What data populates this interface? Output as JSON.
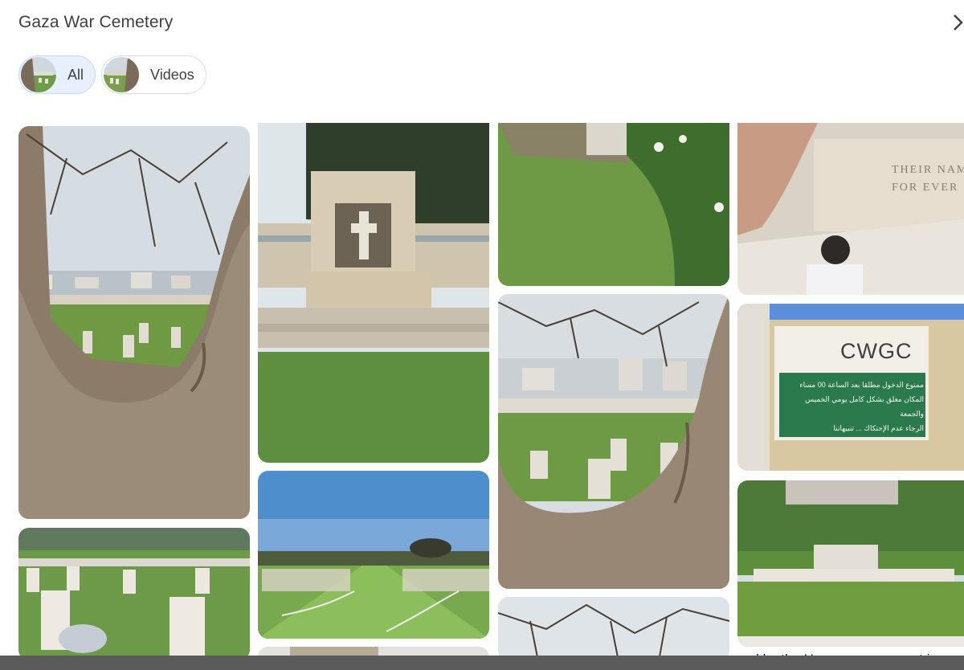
{
  "header": {
    "title": "Gaza War Cemetery"
  },
  "icons": {
    "close": "chevron-right-icon"
  },
  "filters": [
    {
      "label": "All",
      "selected": true
    },
    {
      "label": "Videos",
      "selected": false
    }
  ],
  "photos": {
    "memorial_inscription": "THEIR NAME\nFOR EVER",
    "sign_logo": "CWGC",
    "sign_arabic_lines": [
      "ممنوع الدخول مطلقا بعد الساعة 00 مساء",
      "المكان مغلق بشكل كامل يومي الخميس والجمعة",
      "الرجاء عدم الإحتكاك ... تنبيهاتنا"
    ]
  },
  "footer": {
    "partial_text": "managed by the Hamas government in"
  },
  "colors": {
    "accent_chip": "#e8f0fe",
    "text": "#3c4043",
    "bottom_bar": "#5b5b5b"
  }
}
